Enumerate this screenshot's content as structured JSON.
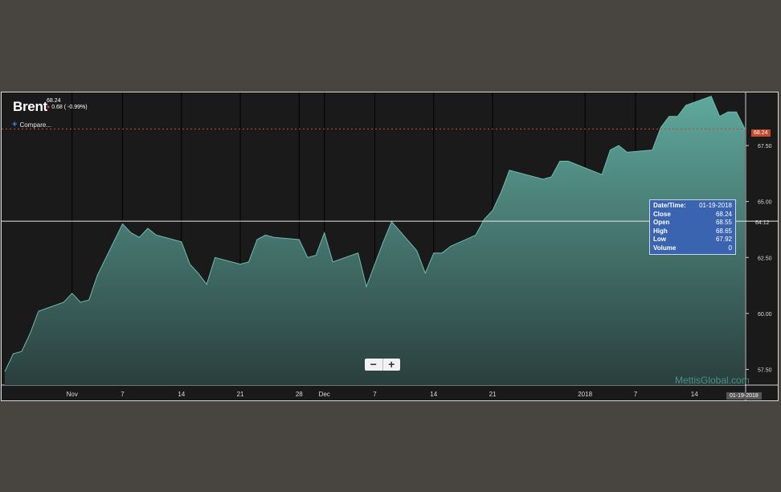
{
  "header": {
    "ticker": "Brent",
    "last_price": "68.24",
    "change": "0.68 ( -0.99%)",
    "compare_label": "Compare..."
  },
  "tooltip": {
    "rows": [
      {
        "label": "Date/Time:",
        "value": "01-19-2018"
      },
      {
        "label": "Close",
        "value": "68.24"
      },
      {
        "label": "Open",
        "value": "68.55"
      },
      {
        "label": "High",
        "value": "68.65"
      },
      {
        "label": "Low",
        "value": "67.92"
      },
      {
        "label": "Volume",
        "value": "0"
      }
    ]
  },
  "zoom": {
    "minus": "−",
    "plus": "+"
  },
  "watermark": "MettisGlobal.com",
  "date_flag": "01-19-2018",
  "price_tag": "68.24",
  "crosshair_value": "64.12",
  "colors": {
    "background": "#1a1a1a",
    "area_top": "#5fa89d",
    "area_bottom": "#2a3f3d",
    "line": "#6cbcb0",
    "price_tag": "#c54a2c",
    "tooltip": "#3a63b0"
  },
  "chart_data": {
    "type": "area",
    "ylim": [
      56.8,
      69.8
    ],
    "grid": true,
    "y_ticks": [
      "57.50",
      "60.00",
      "62.50",
      "65.00",
      "67.50"
    ],
    "x_tick_labels": [
      "Nov",
      "7",
      "14",
      "21",
      "28",
      "Dec",
      "7",
      "14",
      "21",
      "2018",
      "7",
      "14"
    ],
    "dates": [
      "2017-10-23",
      "2017-10-24",
      "2017-10-25",
      "2017-10-26",
      "2017-10-27",
      "2017-10-30",
      "2017-10-31",
      "2017-11-01",
      "2017-11-02",
      "2017-11-03",
      "2017-11-06",
      "2017-11-07",
      "2017-11-08",
      "2017-11-09",
      "2017-11-10",
      "2017-11-13",
      "2017-11-14",
      "2017-11-15",
      "2017-11-16",
      "2017-11-17",
      "2017-11-20",
      "2017-11-21",
      "2017-11-22",
      "2017-11-23",
      "2017-11-24",
      "2017-11-27",
      "2017-11-28",
      "2017-11-29",
      "2017-11-30",
      "2017-12-01",
      "2017-12-04",
      "2017-12-05",
      "2017-12-06",
      "2017-12-07",
      "2017-12-08",
      "2017-12-11",
      "2017-12-12",
      "2017-12-13",
      "2017-12-14",
      "2017-12-15",
      "2017-12-18",
      "2017-12-19",
      "2017-12-20",
      "2017-12-21",
      "2017-12-22",
      "2017-12-26",
      "2017-12-27",
      "2017-12-28",
      "2017-12-29",
      "2018-01-02",
      "2018-01-03",
      "2018-01-04",
      "2018-01-05",
      "2018-01-08",
      "2018-01-09",
      "2018-01-10",
      "2018-01-11",
      "2018-01-12",
      "2018-01-15",
      "2018-01-16",
      "2018-01-17",
      "2018-01-18",
      "2018-01-19"
    ],
    "series": [
      {
        "values": [
          57.4,
          58.2,
          58.3,
          59.1,
          60.1,
          60.5,
          60.9,
          60.5,
          60.6,
          61.7,
          64.0,
          63.6,
          63.4,
          63.8,
          63.5,
          63.2,
          62.2,
          61.8,
          61.3,
          62.5,
          62.2,
          62.3,
          63.3,
          63.5,
          63.4,
          63.3,
          62.5,
          62.6,
          63.6,
          62.3,
          62.7,
          61.2,
          62.2,
          63.2,
          64.1,
          62.8,
          61.8,
          62.7,
          62.7,
          63.0,
          63.5,
          64.2,
          64.6,
          65.4,
          66.4,
          66.0,
          66.1,
          66.8,
          66.8,
          66.2,
          67.3,
          67.5,
          67.2,
          67.3,
          68.3,
          68.8,
          68.8,
          69.3,
          69.7,
          68.8,
          69.0,
          69.0,
          68.24
        ]
      }
    ]
  }
}
